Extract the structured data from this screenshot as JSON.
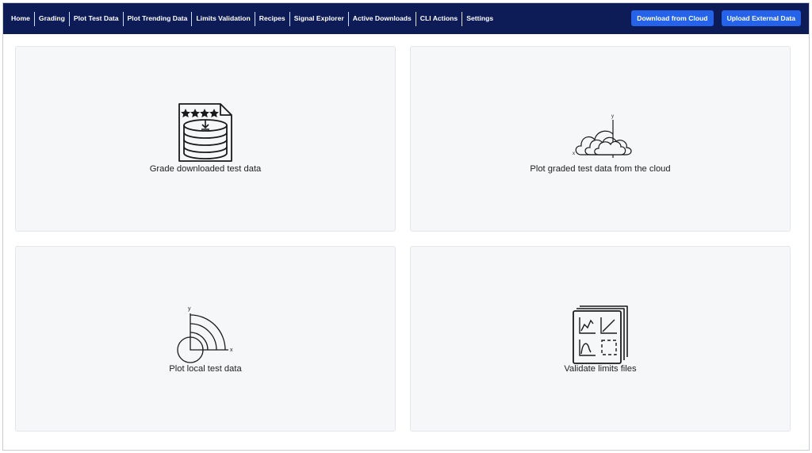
{
  "nav": {
    "links": [
      "Home",
      "Grading",
      "Plot Test Data",
      "Plot Trending Data",
      "Limits Validation",
      "Recipes",
      "Signal Explorer",
      "Active Downloads",
      "CLI Actions",
      "Settings"
    ],
    "actions": {
      "download_label": "Download from Cloud",
      "upload_label": "Upload External Data"
    }
  },
  "cards": {
    "grade": {
      "label": "Grade downloaded test data",
      "icon": "database-rating-document-icon"
    },
    "cloud": {
      "label": "Plot graded test data from the cloud",
      "icon": "cloud-plot-icon"
    },
    "local": {
      "label": "Plot local test data",
      "icon": "polar-plot-icon"
    },
    "limits": {
      "label": "Validate limits files",
      "icon": "chart-documents-icon"
    }
  },
  "colors": {
    "navbar": "#0d1b57",
    "button": "#2563eb",
    "card": "#f6f7f9"
  }
}
